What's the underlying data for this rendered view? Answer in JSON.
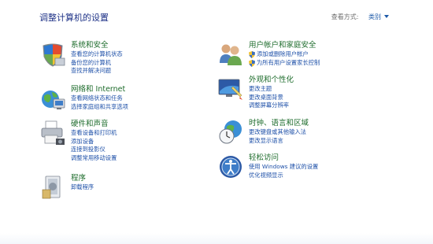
{
  "header": {
    "title": "调整计算机的设置",
    "view_by_label": "查看方式:",
    "view_by_value": "类别"
  },
  "left": [
    {
      "id": "system-security",
      "heading": "系统和安全",
      "links": [
        "查看您的计算机状态",
        "备份您的计算机",
        "查找并解决问题"
      ]
    },
    {
      "id": "network-internet",
      "heading": "网络和 Internet",
      "links": [
        "查看网络状态和任务",
        "选择家庭组和共享选项"
      ]
    },
    {
      "id": "hardware-sound",
      "heading": "硬件和声音",
      "links": [
        "查看设备和打印机",
        "添加设备",
        "连接到投影仪",
        "调整常用移动设置"
      ]
    },
    {
      "id": "programs",
      "heading": "程序",
      "links": [
        "卸载程序"
      ]
    }
  ],
  "right": [
    {
      "id": "user-accounts",
      "heading": "用户帐户和家庭安全",
      "links": [
        "添加或删除用户帐户",
        "为所有用户设置家长控制"
      ]
    },
    {
      "id": "appearance",
      "heading": "外观和个性化",
      "links": [
        "更改主题",
        "更改桌面背景",
        "调整屏幕分辨率"
      ]
    },
    {
      "id": "clock-region",
      "heading": "时钟、语言和区域",
      "links": [
        "更改键盘或其他输入法",
        "更改显示语言"
      ]
    },
    {
      "id": "ease-of-access",
      "heading": "轻松访问",
      "links": [
        "使用 Windows 建议的设置",
        "优化视频显示"
      ]
    }
  ],
  "colors": {
    "heading_green": "#1e6c2c",
    "link_blue": "#1e50a8",
    "title_blue": "#1e3287"
  }
}
